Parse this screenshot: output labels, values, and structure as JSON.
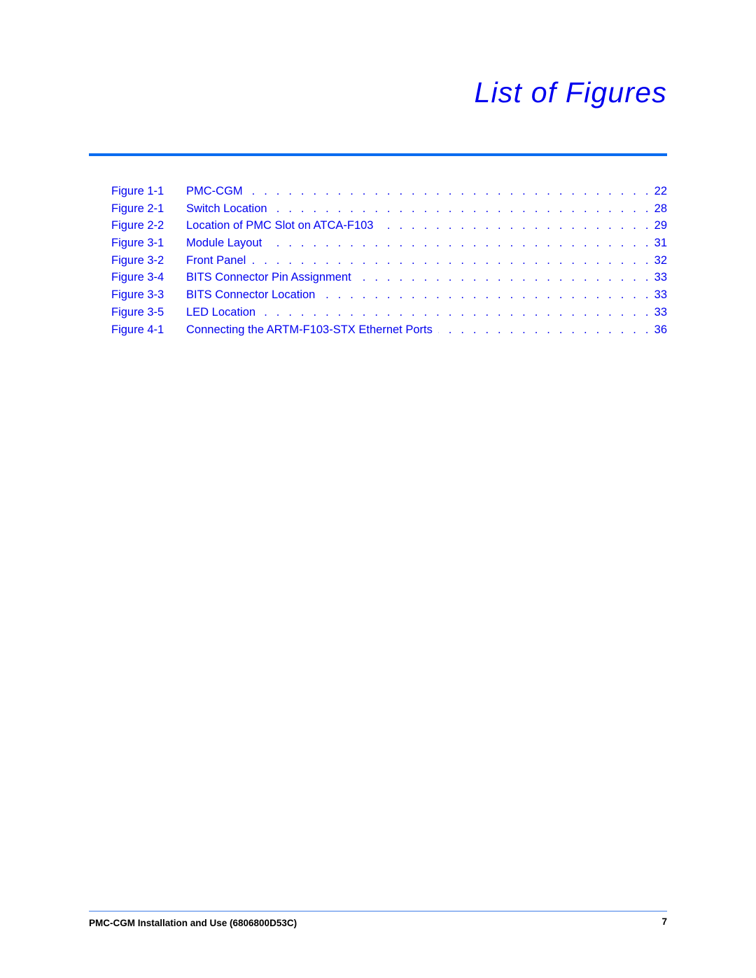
{
  "page": {
    "title": "List of Figures"
  },
  "figures": [
    {
      "number": "Figure 1-1",
      "title": "PMC-CGM",
      "page": "22"
    },
    {
      "number": "Figure 2-1",
      "title": "Switch Location",
      "page": "28"
    },
    {
      "number": "Figure 2-2",
      "title": "Location of PMC Slot on ATCA-F103",
      "page": "29"
    },
    {
      "number": "Figure 3-1",
      "title": "Module Layout",
      "page": "31"
    },
    {
      "number": "Figure 3-2",
      "title": "Front Panel",
      "page": "32"
    },
    {
      "number": "Figure 3-4",
      "title": "BITS Connector Pin Assignment",
      "page": "33"
    },
    {
      "number": "Figure 3-3",
      "title": "BITS Connector Location",
      "page": "33"
    },
    {
      "number": "Figure 3-5",
      "title": "LED Location",
      "page": "33"
    },
    {
      "number": "Figure 4-1",
      "title": "Connecting the ARTM-F103-STX Ethernet Ports",
      "page": "36"
    }
  ],
  "leader": ". . . . . . . . . . . . . . . . . . . . . . . . . . . . . . . . . . . . . . . . . . . . . . . . . . . . . . . . . . . . . . . . . . . . . . . . . . . . . . . . . . . . . . . .",
  "footer": {
    "document_title": "PMC-CGM Installation and Use (6806800D53C)",
    "page_number": "7"
  },
  "colors": {
    "link": "#0000ee",
    "rule": "#0a6cf0",
    "footer_rule": "#3d7be6",
    "footer_text": "#000000"
  }
}
